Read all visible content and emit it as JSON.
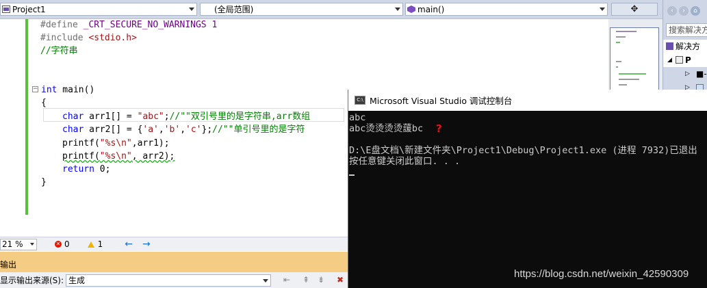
{
  "navbar": {
    "project": "Project1",
    "scope": "(全局范围)",
    "member": "main()",
    "split_icon": "split-icon"
  },
  "code_lines": [
    "#define _CRT_SECURE_NO_WARNINGS 1",
    "#include <stdio.h>",
    "//字符串",
    "int main()",
    "{",
    "char arr1[] = \"abc\";//\"\"双引号里的是字符串,arr数组",
    "char arr2[] = {'a','b','c'};//\"\"单引号里的是字符",
    "printf(\"%s\\n\",arr1);",
    "printf(\"%s\\n\", arr2);",
    "return 0;",
    "}"
  ],
  "code": {
    "define_kw": "#define",
    "define_rest": " _CRT_SECURE_NO_WARNINGS 1",
    "include_kw": "#include",
    "include_rest": " <stdio.h>",
    "comment": "//字符串",
    "int_kw": "int",
    "main_rest": " main()",
    "open_brace": "{",
    "char_kw": "char",
    "arr1_decl": " arr1[] = ",
    "arr1_str": "\"abc\"",
    "arr1_semi": ";",
    "arr1_comment": "//\"\"双引号里的是字符串,arr数组",
    "arr2_decl": " arr2[] = {",
    "a_chr": "'a'",
    "comma": ",",
    "b_chr": "'b'",
    "c_chr": "'c'",
    "arr2_close": "};",
    "arr2_comment": "//\"\"单引号里的是字符",
    "printf1_a": "printf(",
    "fmt_str": "\"%s\\n\"",
    "printf1_b": ",arr1);",
    "printf2_a": "printf(",
    "printf2_b": ", arr2);",
    "return_kw": "return",
    "return_rest": " 0;",
    "close_brace": "}"
  },
  "status": {
    "zoom": "21 %",
    "errors": "0",
    "warnings": "1"
  },
  "output": {
    "title": "输出",
    "source_label": "显示输出来源(S):",
    "source_value": "生成"
  },
  "solution": {
    "search_placeholder": "搜索解决方",
    "item1": "解决方",
    "item2": "P",
    "item3": "■-I",
    "item4": ""
  },
  "console": {
    "title": "Microsoft Visual Studio 调试控制台",
    "line1": "abc",
    "line2": "abc烫烫烫烫蘐bc",
    "line3": "",
    "line4": "D:\\E盘文档\\新建文件夹\\Project1\\Debug\\Project1.exe (进程 7932)已退出",
    "line5": "按任意键关闭此窗口. . ."
  },
  "annotation": "?",
  "watermark": "https://blog.csdn.net/weixin_42590309"
}
